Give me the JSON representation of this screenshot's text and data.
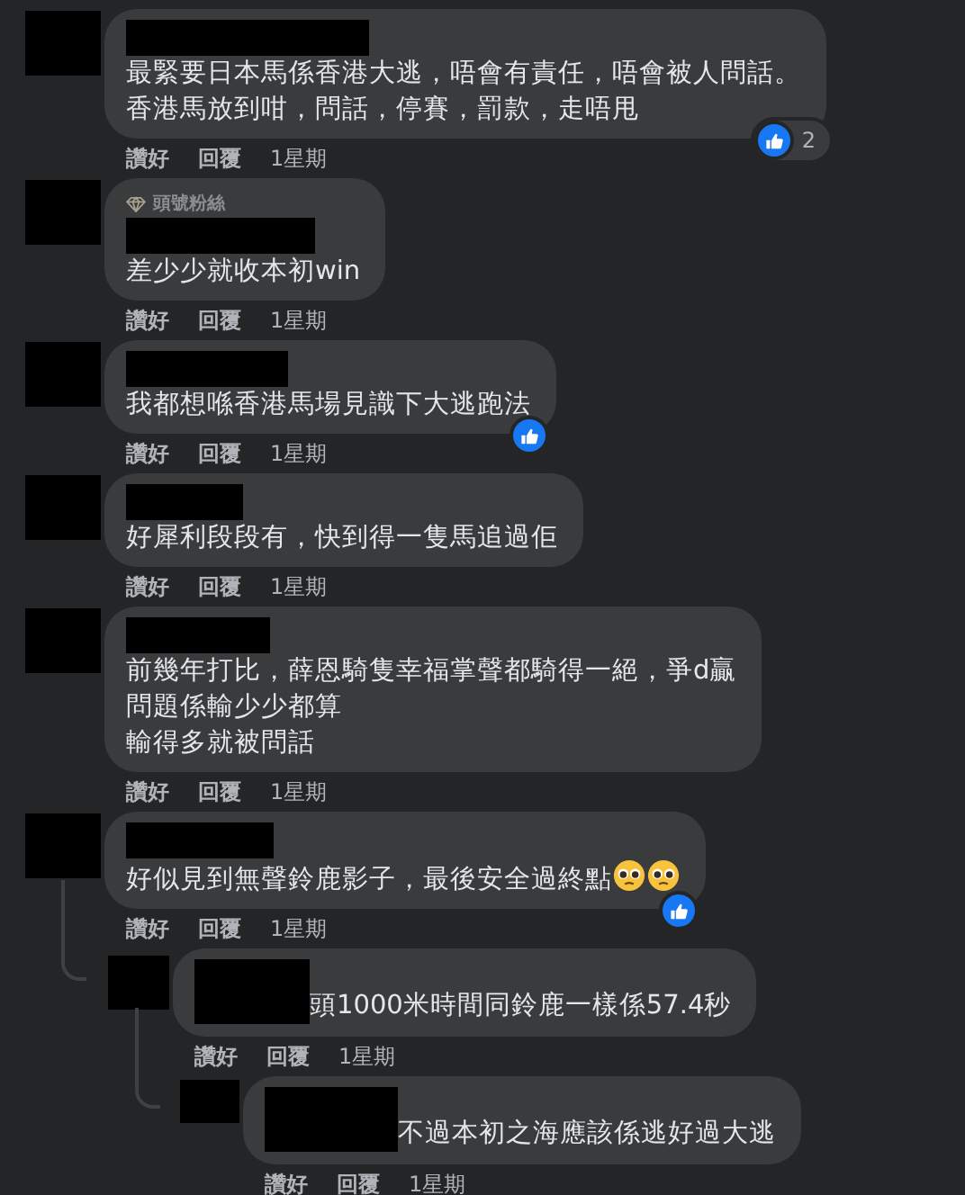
{
  "comments": [
    {
      "lines": [
        "最緊要日本馬係香港大逃，唔會有責任，唔會被人問話。",
        "香港馬放到咁，問話，停賽，罰款，走唔甩"
      ],
      "liked": true,
      "like_count": "2",
      "actions": {
        "like": "讚好",
        "reply": "回覆",
        "time": "1星期"
      }
    },
    {
      "badge": "頭號粉絲",
      "text": "差少少就收本初win",
      "liked": false,
      "actions": {
        "like": "讚好",
        "reply": "回覆",
        "time": "1星期"
      }
    },
    {
      "text": "我都想喺香港馬場見識下大逃跑法",
      "liked": true,
      "actions": {
        "like": "讚好",
        "reply": "回覆",
        "time": "1星期"
      }
    },
    {
      "text": "好犀利段段有，快到得一隻馬追過佢",
      "liked": false,
      "actions": {
        "like": "讚好",
        "reply": "回覆",
        "time": "1星期"
      }
    },
    {
      "lines": [
        "前幾年打比，薛恩騎隻幸福掌聲都騎得一絕，爭d贏",
        "問題係輸少少都算",
        "輸得多就被問話"
      ],
      "liked": false,
      "actions": {
        "like": "讚好",
        "reply": "回覆",
        "time": "1星期"
      }
    },
    {
      "text": "好似見到無聲鈴鹿影子，最後安全過終點",
      "emojis": [
        {
          "kind": "pleading"
        },
        {
          "kind": "pleading"
        }
      ],
      "liked": true,
      "actions": {
        "like": "讚好",
        "reply": "回覆",
        "time": "1星期"
      },
      "children": [
        {
          "text": "頭1000米時間同鈴鹿一樣係57.4秒",
          "liked": false,
          "actions": {
            "like": "讚好",
            "reply": "回覆",
            "time": "1星期"
          },
          "children": [
            {
              "text": "不過本初之海應該係逃好過大逃",
              "liked": false,
              "actions": {
                "like": "讚好",
                "reply": "回覆",
                "time": "1星期"
              }
            }
          ]
        }
      ]
    }
  ]
}
